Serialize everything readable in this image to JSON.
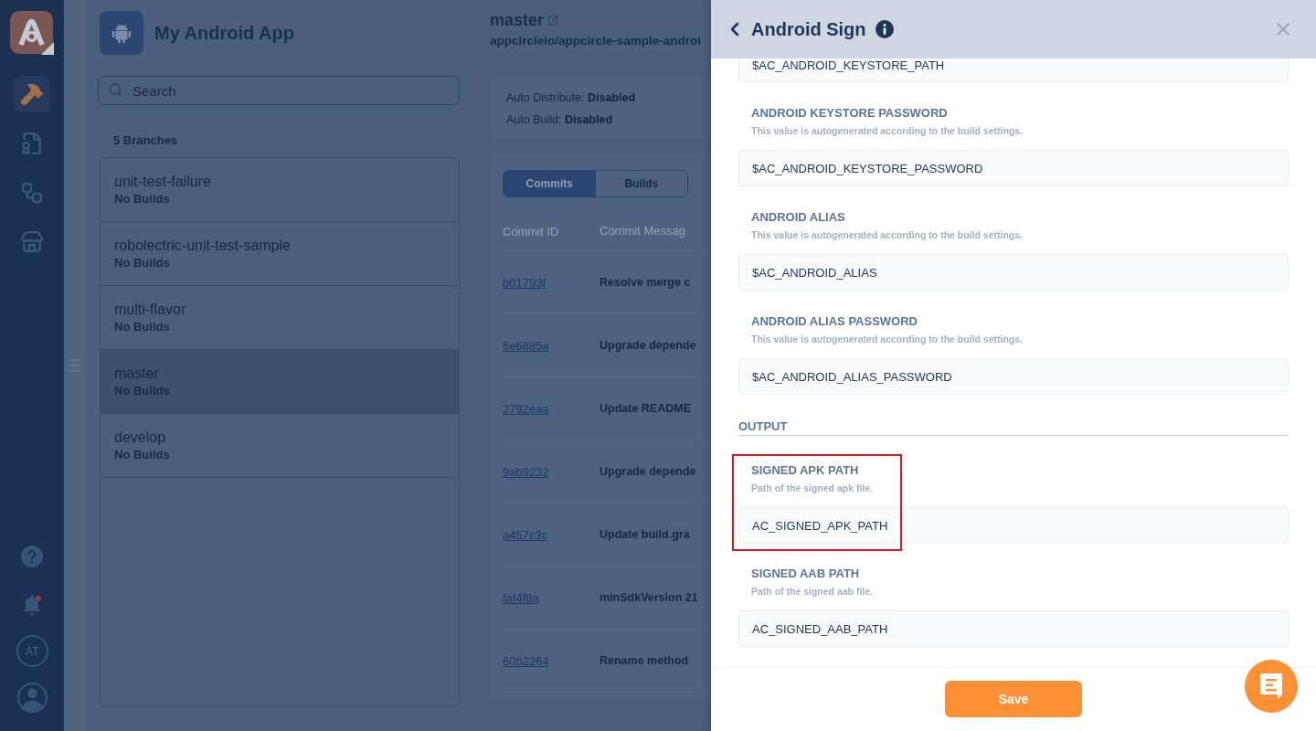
{
  "nav": {
    "items": [
      {
        "kind": "hammer",
        "selected": true
      },
      {
        "kind": "certificate",
        "selected": false
      },
      {
        "kind": "flow",
        "selected": false
      },
      {
        "kind": "store",
        "selected": false
      }
    ],
    "notifications": {
      "unread": true
    },
    "account": {
      "initials": "AT"
    }
  },
  "app": {
    "name": "My Android App"
  },
  "search": {
    "placeholder": "Search"
  },
  "branches": {
    "count": "5 Branches",
    "items": [
      {
        "name": "unit-test-failure",
        "status": "No Builds",
        "selected": false
      },
      {
        "name": "robolectric-unit-test-sample",
        "status": "No Builds",
        "selected": false
      },
      {
        "name": "multi-flavor",
        "status": "No Builds",
        "selected": false
      },
      {
        "name": "master",
        "status": "No Builds",
        "selected": true
      },
      {
        "name": "develop",
        "status": "No Builds",
        "selected": false
      }
    ]
  },
  "branch": {
    "name": "master",
    "repo": "appcircleio/appcircle-sample-androi",
    "settings": [
      "Auto Distribute: **Disabled**",
      "Auto Build: **Disabled**"
    ],
    "tabs": [
      {
        "label": "Commits",
        "selected": true
      },
      {
        "label": "Builds",
        "selected": false
      }
    ],
    "table": {
      "columns": [
        "Commit ID",
        "Commit Messag"
      ],
      "rows": [
        {
          "id": "b01793f",
          "message": "Resolve merge c"
        },
        {
          "id": "6e6885a",
          "message": "Upgrade depende"
        },
        {
          "id": "2792eaa",
          "message": "Update README"
        },
        {
          "id": "9ab9232",
          "message": "Upgrade depende"
        },
        {
          "id": "a457c3c",
          "message": "Update build.gra"
        },
        {
          "id": "faf4f8a",
          "message": "minSdkVersion 21"
        },
        {
          "id": "60b2264",
          "message": "Rename method"
        }
      ]
    }
  },
  "drawer": {
    "title": "Android Sign",
    "inputs": [
      {
        "value": "$AC_ANDROID_KEYSTORE_PATH"
      },
      {
        "label": "ANDROID KEYSTORE PASSWORD",
        "hint": "This value is autogenerated according to the build settings.",
        "value": "$AC_ANDROID_KEYSTORE_PASSWORD"
      },
      {
        "label": "ANDROID ALIAS",
        "hint": "This value is autogenerated according to the build settings.",
        "value": "$AC_ANDROID_ALIAS"
      },
      {
        "label": "ANDROID ALIAS PASSWORD",
        "hint": "This value is autogenerated according to the build settings.",
        "value": "$AC_ANDROID_ALIAS_PASSWORD"
      }
    ],
    "output": {
      "title": "OUTPUT",
      "fields": [
        {
          "label": "SIGNED APK PATH",
          "hint": "Path of the signed apk file.",
          "value": "AC_SIGNED_APK_PATH",
          "highlighted": true
        },
        {
          "label": "SIGNED AAB PATH",
          "hint": "Path of the signed aab file.",
          "value": "AC_SIGNED_AAB_PATH",
          "highlighted": false
        }
      ]
    },
    "save_label": "Save"
  }
}
